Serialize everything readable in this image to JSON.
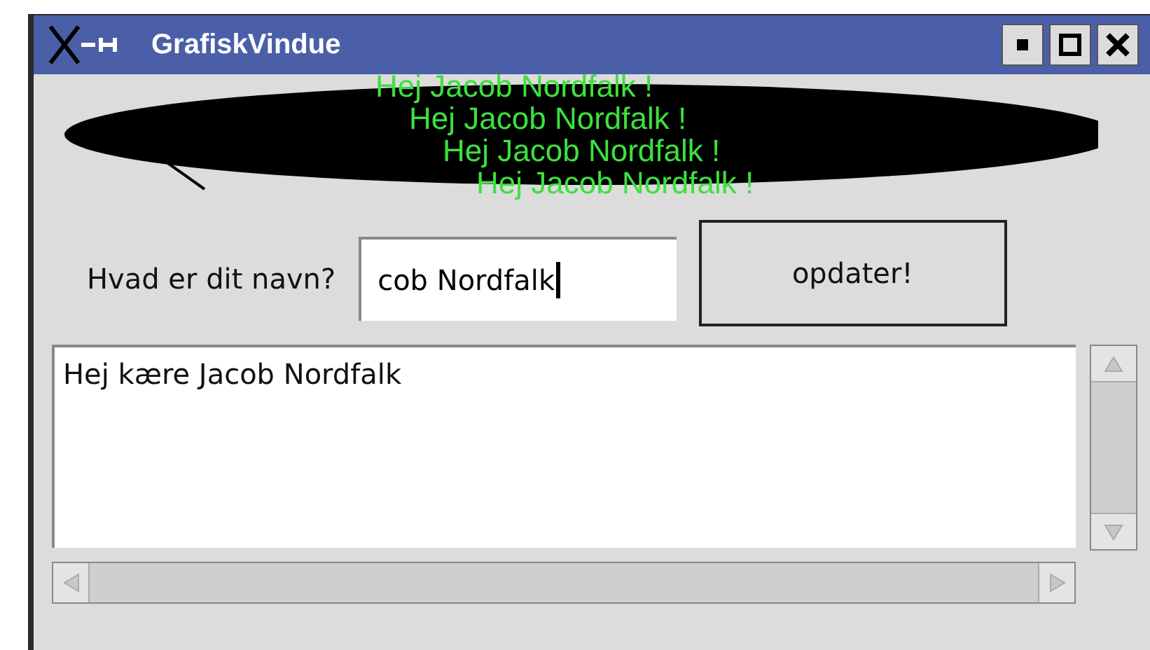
{
  "window": {
    "title": "GrafiskVindue"
  },
  "canvas": {
    "greetings": [
      "Hej Jacob Nordfalk !",
      "Hej Jacob Nordfalk !",
      "Hej Jacob Nordfalk !",
      "Hej Jacob Nordfalk !"
    ]
  },
  "form": {
    "label": "Hvad er dit navn?",
    "name_field": {
      "value": "cob Nordfalk"
    },
    "button": "opdater!"
  },
  "text_area": {
    "text": "Hej kære Jacob Nordfalk"
  }
}
